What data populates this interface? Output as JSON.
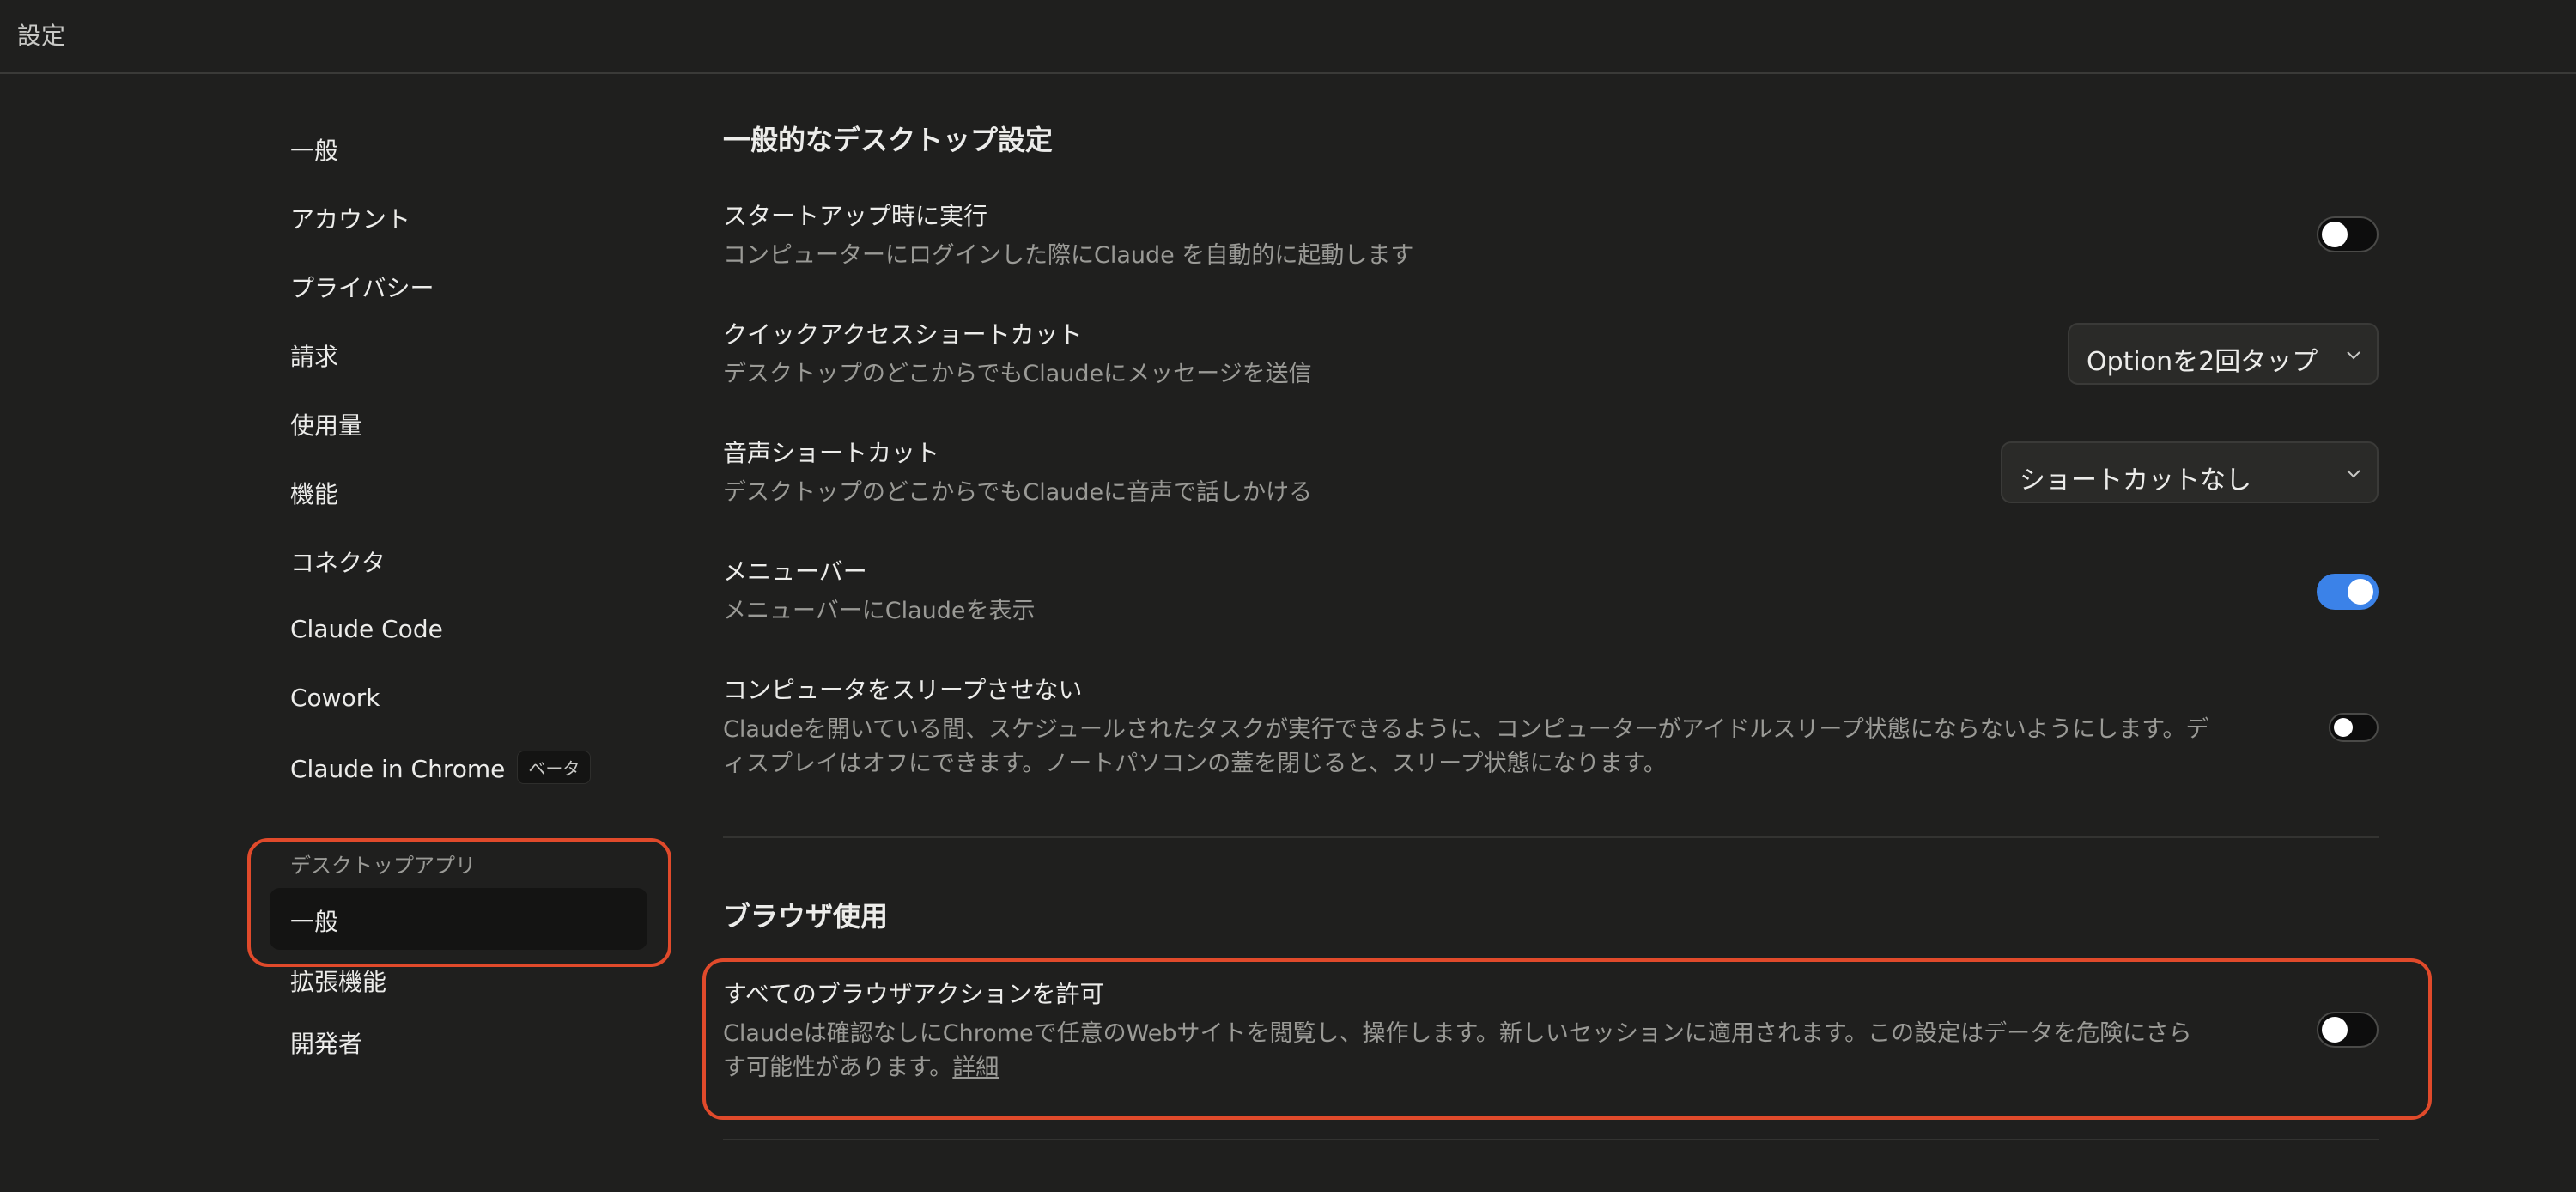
{
  "window": {
    "title": "設定"
  },
  "sidebar": {
    "items": [
      {
        "label": "一般"
      },
      {
        "label": "アカウント"
      },
      {
        "label": "プライバシー"
      },
      {
        "label": "請求"
      },
      {
        "label": "使用量"
      },
      {
        "label": "機能"
      },
      {
        "label": "コネクタ"
      },
      {
        "label": "Claude Code"
      },
      {
        "label": "Cowork"
      },
      {
        "label": "Claude in Chrome",
        "badge": "ベータ"
      }
    ],
    "desktop_group": {
      "label": "デスクトップアプリ",
      "active_item": "一般",
      "items": [
        {
          "label": "拡張機能"
        },
        {
          "label": "開発者"
        }
      ]
    }
  },
  "main": {
    "desktop_section": {
      "title": "一般的なデスクトップ設定",
      "startup": {
        "title": "スタートアップ時に実行",
        "desc": "コンピューターにログインした際にClaude を自動的に起動します",
        "enabled": false
      },
      "quick_access": {
        "title": "クイックアクセスショートカット",
        "desc": "デスクトップのどこからでもClaudeにメッセージを送信",
        "value": "Optionを2回タップ"
      },
      "voice": {
        "title": "音声ショートカット",
        "desc": "デスクトップのどこからでもClaudeに音声で話しかける",
        "value": "ショートカットなし"
      },
      "menubar": {
        "title": "メニューバー",
        "desc": "メニューバーにClaudeを表示",
        "enabled": true
      },
      "sleep": {
        "title": "コンピュータをスリープさせない",
        "desc_line1": "Claudeを開いている間、スケジュールされたタスクが実行できるように、コンピューターがアイドルスリープ状態にならないようにします。デ",
        "desc_line2": "ィスプレイはオフにできます。ノートパソコンの蓋を閉じると、スリープ状態になります。",
        "enabled": false
      }
    },
    "browser_section": {
      "title": "ブラウザ使用",
      "allow_all": {
        "title": "すべてのブラウザアクションを許可",
        "desc_line1": "Claudeは確認なしにChromeで任意のWebサイトを閲覧し、操作します。新しいセッションに適用されます。この設定はデータを危険にさら",
        "desc_line2": "す可能性があります。",
        "link": "詳細",
        "enabled": false
      }
    }
  },
  "colors": {
    "accent_toggle": "#3b82e8",
    "highlight": "#e04a2b",
    "background": "#1f1f1e"
  }
}
